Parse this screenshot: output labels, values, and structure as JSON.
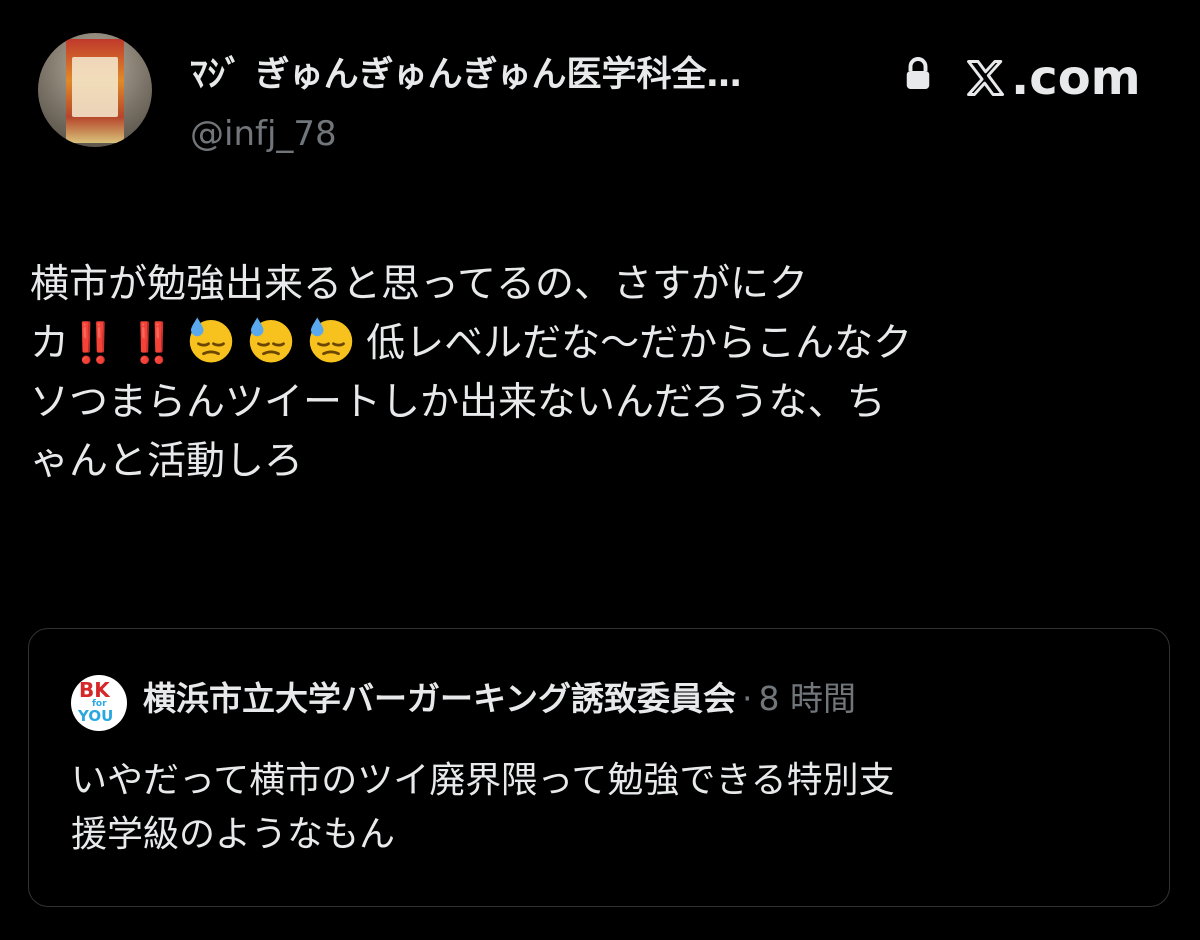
{
  "post": {
    "author": {
      "display_name": "ﾏｼﾞ ぎゅんぎゅんぎゅん医学科全…",
      "handle": "@infj_78",
      "avatar": "food-package-avatar",
      "protected_icon": "lock-icon"
    },
    "brand": {
      "logo_icon": "x-logo-icon",
      "text": ".com"
    },
    "body": {
      "line1": "横市が勉強出来ると思ってるの、さすがにク",
      "line2_prefix": "カ",
      "line2_excl": "‼️",
      "line2_emoji": "sweat-face-emoji",
      "line2_suffix": "低レベルだな〜だからこんなク",
      "line3": "ソつまらんツイートしか出来ないんだろうな、ち",
      "line4": "ゃんと活動しろ"
    },
    "quoted": {
      "avatar_text": {
        "bk": "BK",
        "for": "for",
        "you": "YOU"
      },
      "name": "横浜市立大学バーガーキング誘致委員会",
      "separator": "·",
      "time": "8 時間",
      "line1": "いやだって横市のツイ廃界隈って勉強できる特別支",
      "line2": "援学級のようなもん"
    }
  },
  "colors": {
    "background": "#000000",
    "primary_text": "#e7e9ea",
    "secondary_text": "#71767b",
    "border": "#2f3336",
    "exclamation": "#e0242c"
  }
}
